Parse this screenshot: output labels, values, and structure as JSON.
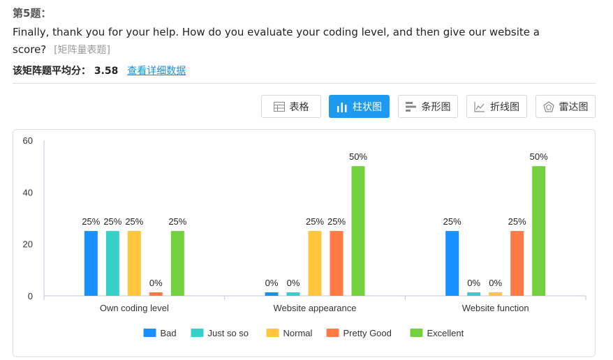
{
  "question": {
    "number": "第5题：",
    "text": "Finally, thank you for your help. How do you evaluate your coding level, and then give our website a score?",
    "type_tag": "[矩阵量表题]",
    "average_label": "该矩阵题平均分：",
    "average_value": "3.58",
    "detail_link": "查看详细数据"
  },
  "toolbar": {
    "buttons": [
      {
        "label": "表格",
        "icon": "table-icon",
        "active": false
      },
      {
        "label": "柱状图",
        "icon": "bar-chart-icon",
        "active": true
      },
      {
        "label": "条形图",
        "icon": "horizontal-bar-icon",
        "active": false
      },
      {
        "label": "折线图",
        "icon": "line-chart-icon",
        "active": false
      },
      {
        "label": "雷达图",
        "icon": "radar-chart-icon",
        "active": false
      }
    ]
  },
  "colors": {
    "Bad": "#1890ff",
    "Just so so": "#36cfc9",
    "Normal": "#ffc53d",
    "Pretty Good": "#ff7a45",
    "Excellent": "#73d13d",
    "active_button": "#1e9bf0",
    "link": "#1a90d9"
  },
  "chart_data": {
    "type": "bar",
    "categories": [
      "Own coding level",
      "Website appearance",
      "Website function"
    ],
    "series": [
      {
        "name": "Bad",
        "values": [
          25,
          0,
          25
        ],
        "labels": [
          "25%",
          "0%",
          "25%"
        ]
      },
      {
        "name": "Just so so",
        "values": [
          25,
          0,
          0
        ],
        "labels": [
          "25%",
          "0%",
          "0%"
        ]
      },
      {
        "name": "Normal",
        "values": [
          25,
          25,
          0
        ],
        "labels": [
          "25%",
          "25%",
          "0%"
        ]
      },
      {
        "name": "Pretty Good",
        "values": [
          0,
          25,
          25
        ],
        "labels": [
          "0%",
          "25%",
          "25%"
        ]
      },
      {
        "name": "Excellent",
        "values": [
          25,
          50,
          50
        ],
        "labels": [
          "25%",
          "50%",
          "50%"
        ]
      }
    ],
    "yticks": [
      "0",
      "20",
      "40",
      "60"
    ],
    "ylim": [
      0,
      60
    ],
    "grid": false,
    "legend_position": "bottom"
  }
}
